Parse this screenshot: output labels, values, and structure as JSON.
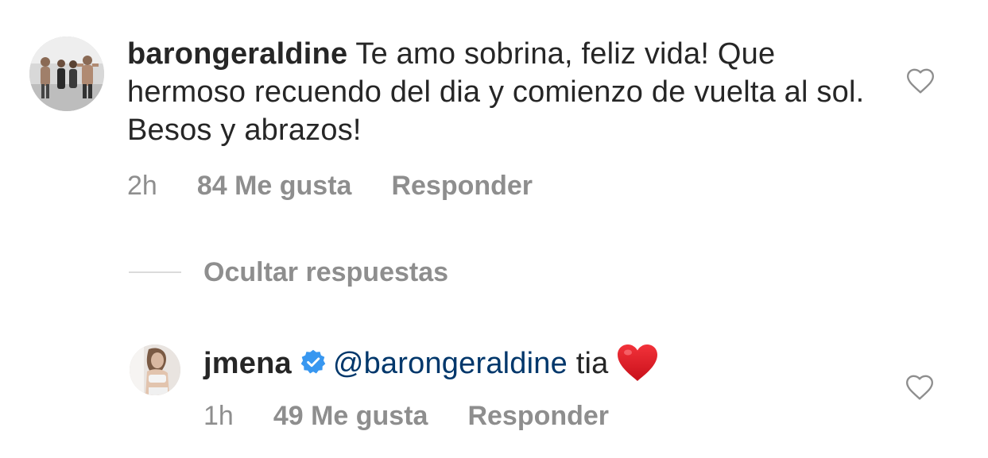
{
  "comment": {
    "username": "barongeraldine",
    "text": "Te amo sobrina, feliz vida! Que hermoso recuendo del dia y comienzo de vuelta al sol. Besos y abrazos!",
    "time": "2h",
    "likes": "84 Me gusta",
    "reply_label": "Responder",
    "avatar_icon": "profile-photo-group",
    "like_icon": "heart-outline-icon"
  },
  "replies_toggle": {
    "label": "Ocultar respuestas"
  },
  "reply": {
    "username": "jmena",
    "verified_icon": "verified-badge-icon",
    "mention": "@barongeraldine",
    "text": "tia",
    "emoji": "red-heart-emoji",
    "time": "1h",
    "likes": "49 Me gusta",
    "reply_label": "Responder",
    "avatar_icon": "profile-photo",
    "like_icon": "heart-outline-icon"
  },
  "colors": {
    "text": "#262626",
    "muted": "#8e8e8e",
    "mention": "#00376b",
    "verified": "#3897f0",
    "heart_red": "#ed1c24",
    "divider": "#dbdbdb"
  }
}
